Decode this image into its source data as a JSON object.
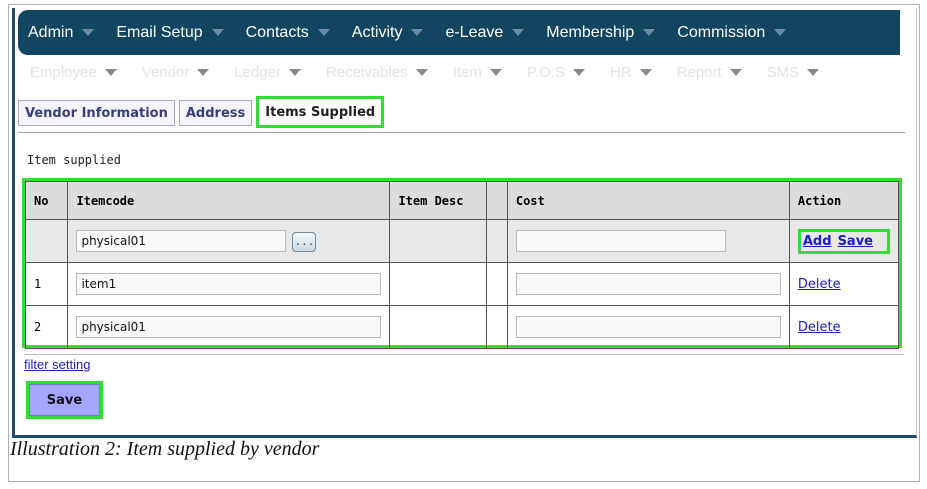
{
  "topnav": {
    "items": [
      {
        "label": "Admin"
      },
      {
        "label": "Email Setup"
      },
      {
        "label": "Contacts"
      },
      {
        "label": "Activity"
      },
      {
        "label": "e-Leave"
      },
      {
        "label": "Membership"
      },
      {
        "label": "Commission"
      }
    ]
  },
  "subnav": {
    "items": [
      {
        "label": "Employee"
      },
      {
        "label": "Vendor"
      },
      {
        "label": "Ledger"
      },
      {
        "label": "Receivables"
      },
      {
        "label": "Item"
      },
      {
        "label": "P.O.S"
      },
      {
        "label": "HR"
      },
      {
        "label": "Report"
      },
      {
        "label": "SMS"
      }
    ]
  },
  "tabs": [
    {
      "label": "Vendor Information"
    },
    {
      "label": "Address"
    },
    {
      "label": "Items Supplied",
      "active": true
    }
  ],
  "section": {
    "title": "Item supplied"
  },
  "table": {
    "headers": [
      "No",
      "Itemcode",
      "Item Desc",
      "",
      "Cost",
      "Action"
    ],
    "new_row": {
      "itemcode": "physical01",
      "browse_label": "...",
      "desc": "",
      "cost": "",
      "add_label": "Add",
      "save_label": "Save"
    },
    "rows": [
      {
        "no": "1",
        "itemcode": "item1",
        "desc": "",
        "cost": "",
        "delete_label": "Delete"
      },
      {
        "no": "2",
        "itemcode": "physical01",
        "desc": "",
        "cost": "",
        "delete_label": "Delete"
      }
    ]
  },
  "filter_label": "filter setting",
  "save_button": "Save",
  "caption": "Illustration 2: Item supplied by vendor",
  "colors": {
    "nav_bg": "#124560",
    "highlight": "#33dd33",
    "save_bg": "#a7a4ff",
    "link": "#1c1cc8"
  }
}
